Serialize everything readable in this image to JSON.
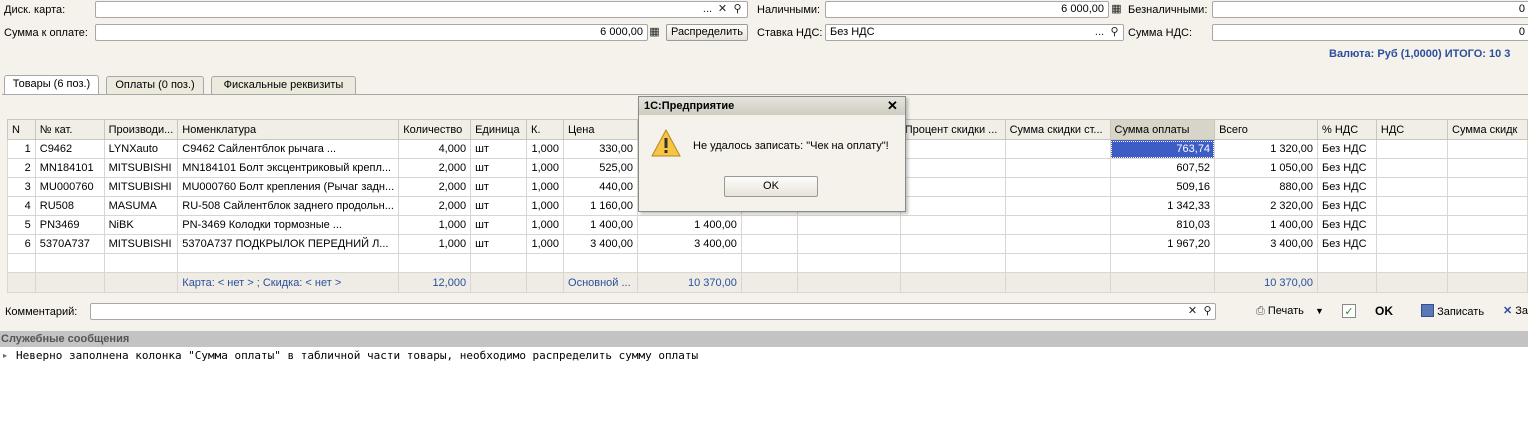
{
  "header": {
    "disc_card_label": "Диск. карта:",
    "disc_card_value": "",
    "cash_label": "Наличными:",
    "cash_value": "6 000,00",
    "noncash_label": "Безналичными:",
    "noncash_value": "0",
    "pay_sum_label": "Сумма к оплате:",
    "pay_sum_value": "6 000,00",
    "distribute_button": "Распределить",
    "vat_rate_label": "Ставка НДС:",
    "vat_rate_value": "Без НДС",
    "vat_sum_label": "Сумма НДС:",
    "vat_sum_value": "0",
    "currency_total": "Валюта: Руб (1,0000) ИТОГО: 10 3",
    "dots": "...",
    "clear": "✕",
    "search": "⚲"
  },
  "tabs": [
    {
      "label": "Товары (6 поз.)",
      "active": true
    },
    {
      "label": "Оплаты (0 поз.)",
      "active": false
    },
    {
      "label": "Фискальные реквизиты",
      "active": false
    }
  ],
  "table": {
    "columns": [
      "N",
      "№ кат.",
      "Производи...",
      "Номенклатура",
      "Количество",
      "Единица",
      "К.",
      "Цена",
      "",
      "",
      "",
      "Процент скидки ...",
      "Сумма скидки ст...",
      "Сумма оплаты",
      "Всего",
      "% НДС",
      "НДС",
      "Сумма скидк"
    ],
    "rows": [
      {
        "n": "1",
        "cat": "C9462",
        "maker": "LYNXauto",
        "nom": "C9462          Сайлентблок рычага ...",
        "qty": "4,000",
        "unit": "шт",
        "k": "1,000",
        "price": "330,00",
        "pay": "763,74",
        "total": "1 320,00",
        "vat_pct": "Без НДС"
      },
      {
        "n": "2",
        "cat": "MN184101",
        "maker": "MITSUBISHI",
        "nom": "MN184101 Болт эксцентриковый крепл...",
        "qty": "2,000",
        "unit": "шт",
        "k": "1,000",
        "price": "525,00",
        "pay": "607,52",
        "total": "1 050,00",
        "vat_pct": "Без НДС"
      },
      {
        "n": "3",
        "cat": "MU000760",
        "maker": "MITSUBISHI",
        "nom": "MU000760 Болт крепления (Рычаг задн...",
        "qty": "2,000",
        "unit": "шт",
        "k": "1,000",
        "price": "440,00",
        "pay": "509,16",
        "total": "880,00",
        "vat_pct": "Без НДС"
      },
      {
        "n": "4",
        "cat": "RU508",
        "maker": "MASUMA",
        "nom": "RU-508 Сайлентблок заднего продольн...",
        "qty": "2,000",
        "unit": "шт",
        "k": "1,000",
        "price": "1 160,00",
        "pay": "1 342,33",
        "total": "2 320,00",
        "vat_pct": "Без НДС"
      },
      {
        "n": "5",
        "cat": "PN3469",
        "maker": "NiBK",
        "nom": "PN-3469          Колодки тормозные ...",
        "qty": "1,000",
        "unit": "шт",
        "k": "1,000",
        "price": "1 400,00",
        "c9": "1 400,00",
        "pay": "810,03",
        "total": "1 400,00",
        "vat_pct": "Без НДС"
      },
      {
        "n": "6",
        "cat": "5370A737",
        "maker": "MITSUBISHI",
        "nom": "5370A737 ПОДКРЫЛОК ПЕРЕДНИЙ Л...",
        "qty": "1,000",
        "unit": "шт",
        "k": "1,000",
        "price": "3 400,00",
        "c9": "3 400,00",
        "pay": "1 967,20",
        "total": "3 400,00",
        "vat_pct": "Без НДС"
      }
    ],
    "footer": {
      "card_info": "Карта: < нет > ; Скидка: < нет >",
      "qty_total": "12,000",
      "price_type": "Основной ...",
      "sum_total": "10 370,00",
      "total_total": "10 370,00"
    }
  },
  "dialog": {
    "title": "1С:Предприятие",
    "message": "Не удалось записать: \"Чек на оплату\"!",
    "ok": "OK",
    "close": "✕"
  },
  "bottom": {
    "comment_label": "Комментарий:",
    "comment_value": "",
    "print": "Печать",
    "ok": "OK",
    "save": "Записать",
    "close_partial": "За"
  },
  "messages": {
    "header": "Служебные сообщения",
    "text": "Неверно заполнена колонка \"Сумма оплаты\" в табличной части товары, необходимо распределить сумму оплаты"
  }
}
